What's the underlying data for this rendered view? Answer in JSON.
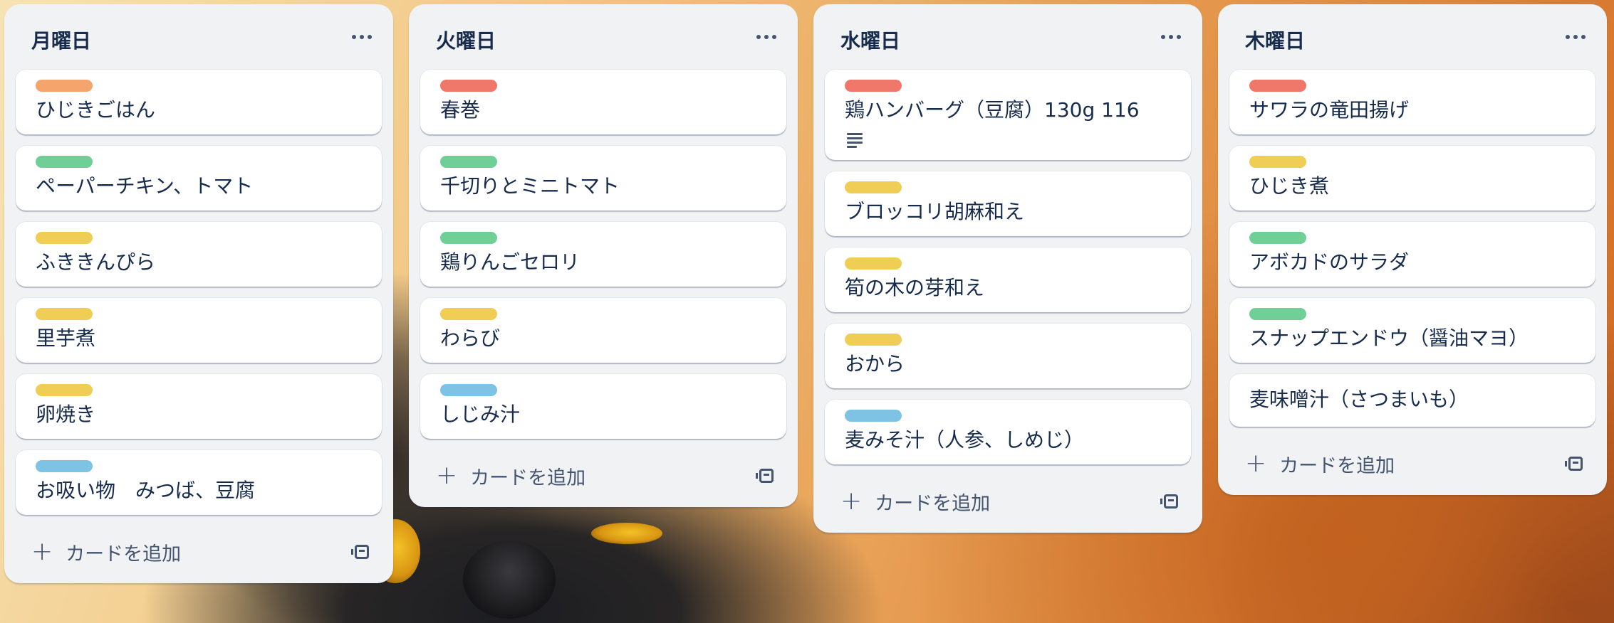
{
  "label_colors": {
    "orange": "#f5a56c",
    "red": "#f0786b",
    "green": "#6fcf97",
    "yellow": "#f0cd55",
    "blue": "#7ec3e3"
  },
  "board": {
    "add_card_label": "カードを追加",
    "menu_icon": "more-horizontal-icon",
    "template_icon": "card-template-icon",
    "lists": [
      {
        "title": "月曜日",
        "cards": [
          {
            "title": "ひじきごはん",
            "label": "orange"
          },
          {
            "title": "ペーパーチキン、トマト",
            "label": "green"
          },
          {
            "title": "ふききんぴら",
            "label": "yellow"
          },
          {
            "title": "里芋煮",
            "label": "yellow"
          },
          {
            "title": "卵焼き",
            "label": "yellow"
          },
          {
            "title": "お吸い物　みつば、豆腐",
            "label": "blue"
          }
        ]
      },
      {
        "title": "火曜日",
        "cards": [
          {
            "title": "春巻",
            "label": "red"
          },
          {
            "title": "千切りとミニトマト",
            "label": "green"
          },
          {
            "title": "鶏りんごセロリ",
            "label": "green"
          },
          {
            "title": "わらび",
            "label": "yellow"
          },
          {
            "title": "しじみ汁",
            "label": "blue"
          }
        ]
      },
      {
        "title": "水曜日",
        "cards": [
          {
            "title": "鶏ハンバーグ（豆腐）130g 116",
            "label": "red",
            "has_description": true
          },
          {
            "title": "ブロッコリ胡麻和え",
            "label": "yellow"
          },
          {
            "title": "筍の木の芽和え",
            "label": "yellow"
          },
          {
            "title": "おから",
            "label": "yellow"
          },
          {
            "title": "麦みそ汁（人参、しめじ）",
            "label": "blue"
          }
        ]
      },
      {
        "title": "木曜日",
        "cards": [
          {
            "title": "サワラの竜田揚げ",
            "label": "red"
          },
          {
            "title": "ひじき煮",
            "label": "yellow"
          },
          {
            "title": "アボカドのサラダ",
            "label": "green"
          },
          {
            "title": "スナップエンドウ（醤油マヨ）",
            "label": "green"
          },
          {
            "title": "麦味噌汁（さつまいも）",
            "label": null
          }
        ]
      }
    ]
  }
}
